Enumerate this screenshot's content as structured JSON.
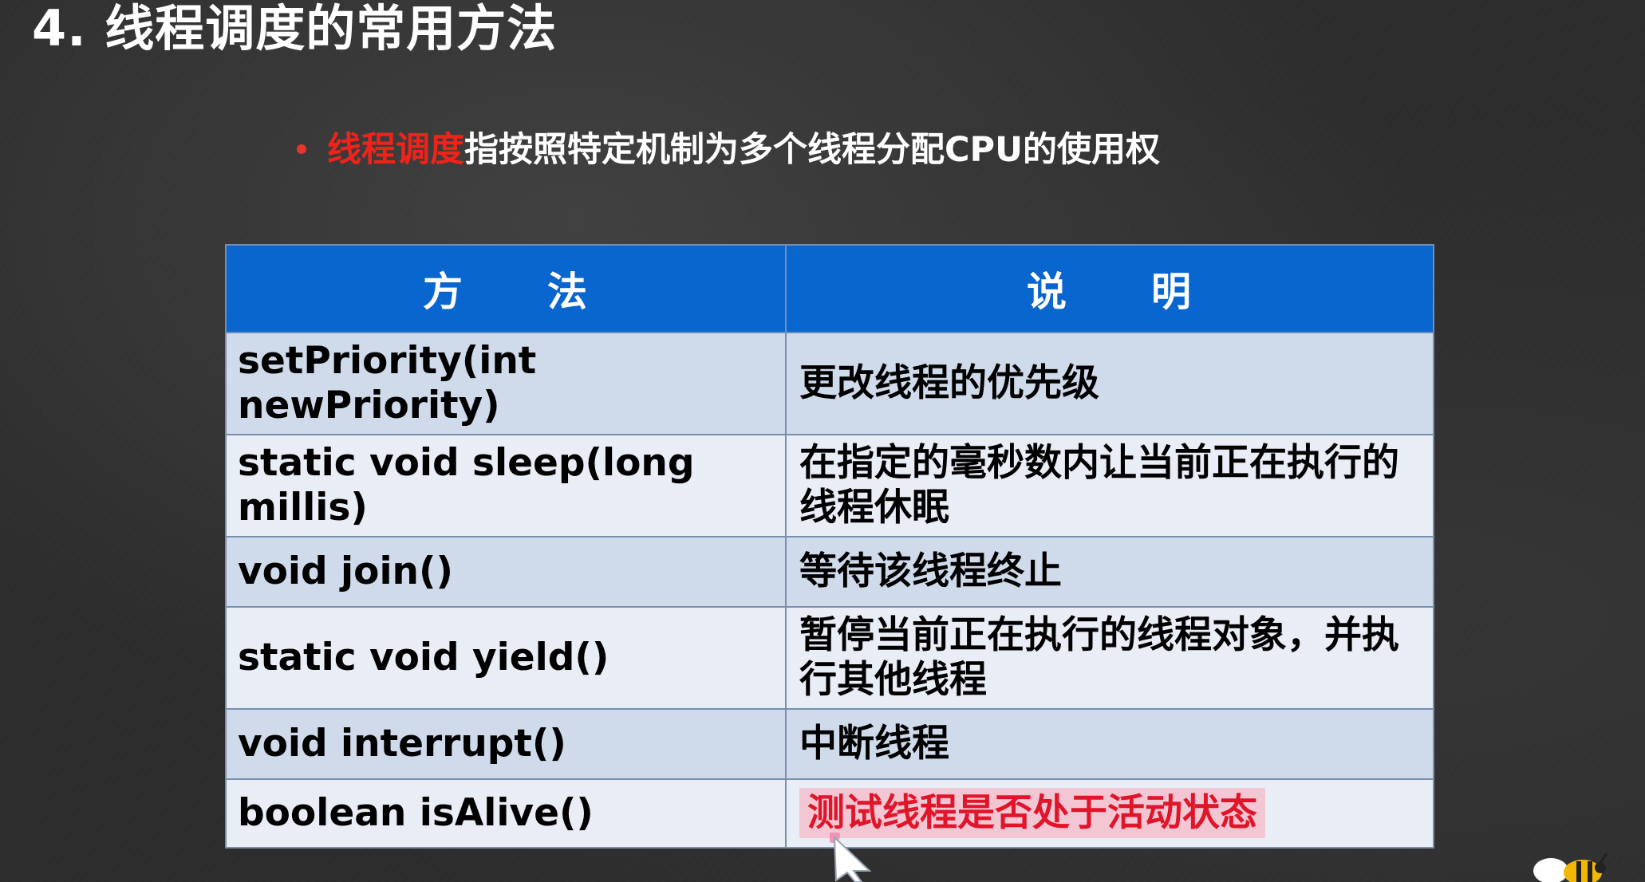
{
  "title": "4. 线程调度的常用方法",
  "bullet": {
    "keyword": "线程调度",
    "text": "指按照特定机制为多个线程分配CPU的使用权"
  },
  "table": {
    "headers": [
      "方　　法",
      "说　　明"
    ],
    "rows": [
      {
        "method": "setPriority(int  newPriority)",
        "description": "更改线程的优先级"
      },
      {
        "method": "static void sleep(long millis)",
        "description": "在指定的毫秒数内让当前正在执行的线程休眠"
      },
      {
        "method": "void join()",
        "description": "等待该线程终止"
      },
      {
        "method": "static void yield()",
        "description": "暂停当前正在执行的线程对象，并执行其他线程"
      },
      {
        "method": "void interrupt()",
        "description": "中断线程"
      },
      {
        "method": "boolean isAlive()",
        "description": "测试线程是否处于活动状态"
      }
    ]
  },
  "colors": {
    "header_bg": "#0a66cf",
    "keyword": "#f0231a",
    "highlight_bg": "#f3c6d4",
    "highlight_text": "#e0152a"
  },
  "icons": [
    "mouse-cursor-icon",
    "bee-mascot-icon"
  ]
}
